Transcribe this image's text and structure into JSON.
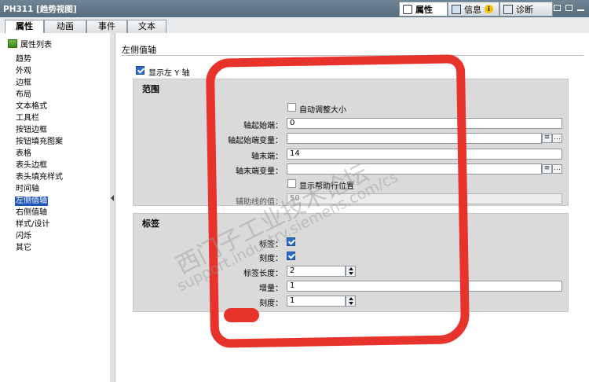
{
  "window": {
    "title": "PH311 [趋势视图]"
  },
  "top_tabs": [
    {
      "label": "属性",
      "icon": "properties-icon",
      "active": true
    },
    {
      "label": "信息",
      "icon": "info-icon",
      "active": false
    },
    {
      "label": "诊断",
      "icon": "diagnostics-icon",
      "active": false
    }
  ],
  "sub_tabs": [
    {
      "label": "属性",
      "active": true
    },
    {
      "label": "动画",
      "active": false
    },
    {
      "label": "事件",
      "active": false
    },
    {
      "label": "文本",
      "active": false
    }
  ],
  "sidebar": {
    "header": "属性列表",
    "items": [
      "趋势",
      "外观",
      "边框",
      "布局",
      "文本格式",
      "工具栏",
      "按钮边框",
      "按钮填充图案",
      "表格",
      "表头边框",
      "表头填充样式",
      "时间轴",
      "左侧值轴",
      "右侧值轴",
      "样式/设计",
      "闪烁",
      "其它"
    ],
    "selected_index": 12
  },
  "section": {
    "title": "左侧值轴",
    "show_left_axis": {
      "label": "显示左 Y 轴",
      "checked": true
    }
  },
  "range_panel": {
    "title": "范围",
    "auto_size": {
      "label": "自动调整大小",
      "checked": false
    },
    "axis_start": {
      "label": "轴起始端：",
      "value": "0"
    },
    "axis_start_var": {
      "label": "轴起始端变量：",
      "value": ""
    },
    "axis_end": {
      "label": "轴末端：",
      "value": "14"
    },
    "axis_end_var": {
      "label": "轴末端变量：",
      "value": ""
    },
    "show_helper": {
      "label": "显示帮助行位置",
      "checked": false
    },
    "helper_value": {
      "label": "辅助线的值：",
      "value": "50"
    }
  },
  "label_panel": {
    "title": "标签",
    "label_check": {
      "label": "标签：",
      "checked": true
    },
    "tick_check": {
      "label": "刻度：",
      "checked": true
    },
    "label_length": {
      "label": "标签长度：",
      "value": "2"
    },
    "increment": {
      "label": "增量：",
      "value": "1"
    },
    "tick_value": {
      "label": "刻度：",
      "value": "1"
    }
  },
  "watermark": {
    "line1": "西门子工业技术论坛",
    "line2": "support.industry.siemens.com/cs"
  },
  "colors": {
    "titlebar": "#5f7687",
    "selection": "#1e56b7",
    "annotation": "#e8322c",
    "panel": "#dadada"
  }
}
